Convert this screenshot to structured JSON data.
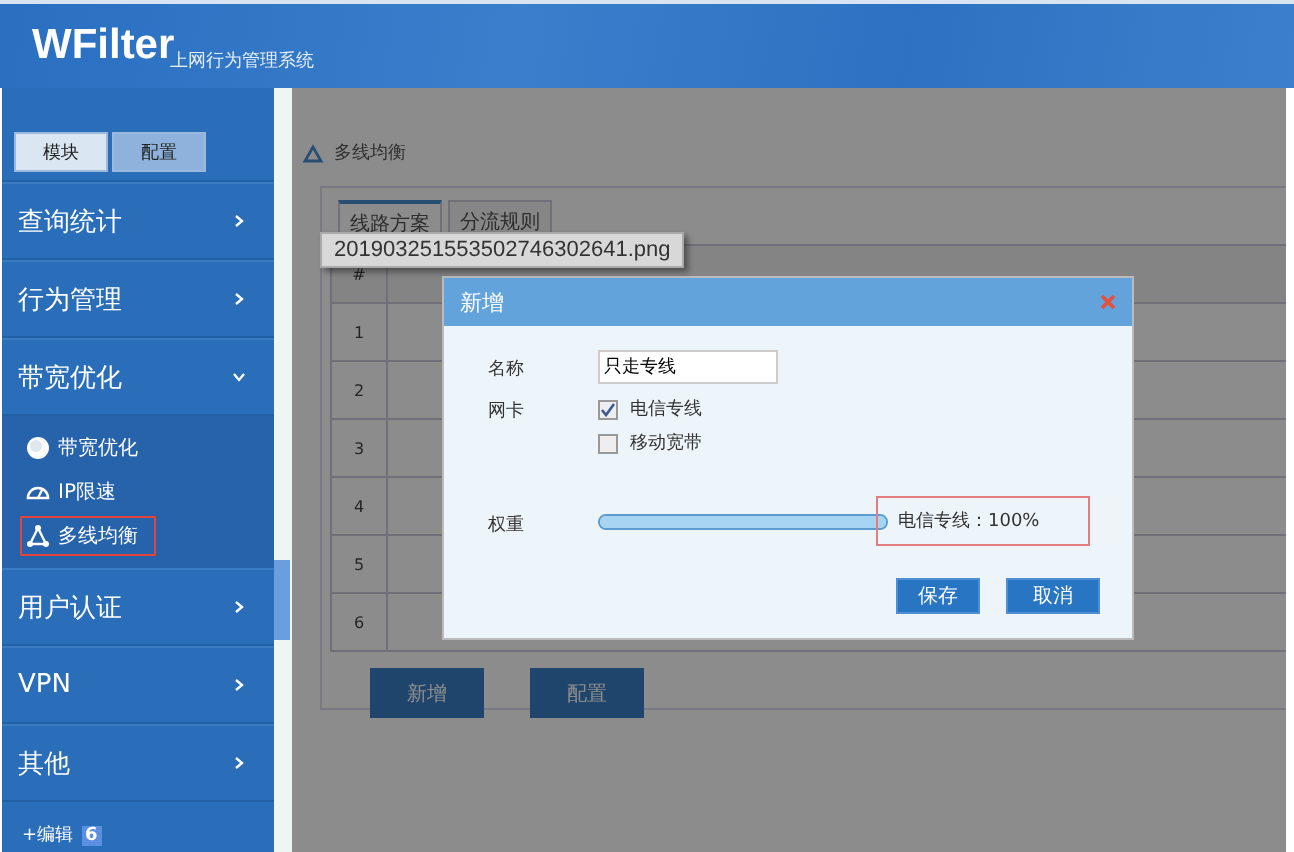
{
  "header": {
    "logo": "WFilter",
    "subtitle": "上网行为管理系统"
  },
  "sidebar": {
    "tabs": [
      {
        "label": "模块",
        "selected": true
      },
      {
        "label": "配置",
        "selected": false
      }
    ],
    "menu": [
      {
        "label": "查询统计",
        "expanded": false
      },
      {
        "label": "行为管理",
        "expanded": false
      },
      {
        "label": "带宽优化",
        "expanded": true,
        "children": [
          {
            "label": "带宽优化",
            "kind": "globe",
            "selected": false
          },
          {
            "label": "IP限速",
            "kind": "gauge",
            "selected": false
          },
          {
            "label": "多线均衡",
            "kind": "network",
            "selected": true
          }
        ]
      },
      {
        "label": "用户认证",
        "expanded": false
      },
      {
        "label": "VPN",
        "expanded": false
      },
      {
        "label": "其他",
        "expanded": false
      }
    ],
    "edit": {
      "label": "+编辑",
      "badge": "6"
    }
  },
  "main": {
    "breadcrumb": "多线均衡",
    "tabs": [
      {
        "label": "线路方案",
        "selected": true
      },
      {
        "label": "分流规则",
        "selected": false
      }
    ],
    "table": {
      "columns": [
        "#"
      ],
      "rows": [
        [
          "1"
        ],
        [
          "2"
        ],
        [
          "3"
        ],
        [
          "4"
        ],
        [
          "5"
        ],
        [
          "6"
        ]
      ]
    },
    "buttons": [
      "新增",
      "配置"
    ]
  },
  "tooltip": "201903251553502746302641.png",
  "dialog": {
    "title": "新增",
    "fields": [
      {
        "kind": "text",
        "label": "名称",
        "value": "只走专线"
      },
      {
        "kind": "checkboxes",
        "label": "网卡",
        "options": [
          {
            "label": "电信专线",
            "checked": true
          },
          {
            "label": "移动宽带",
            "checked": false
          }
        ]
      },
      {
        "kind": "slider",
        "label": "权重",
        "level": 1,
        "reading": "电信专线：100%"
      }
    ],
    "buttons": [
      "保存",
      "取消"
    ]
  }
}
